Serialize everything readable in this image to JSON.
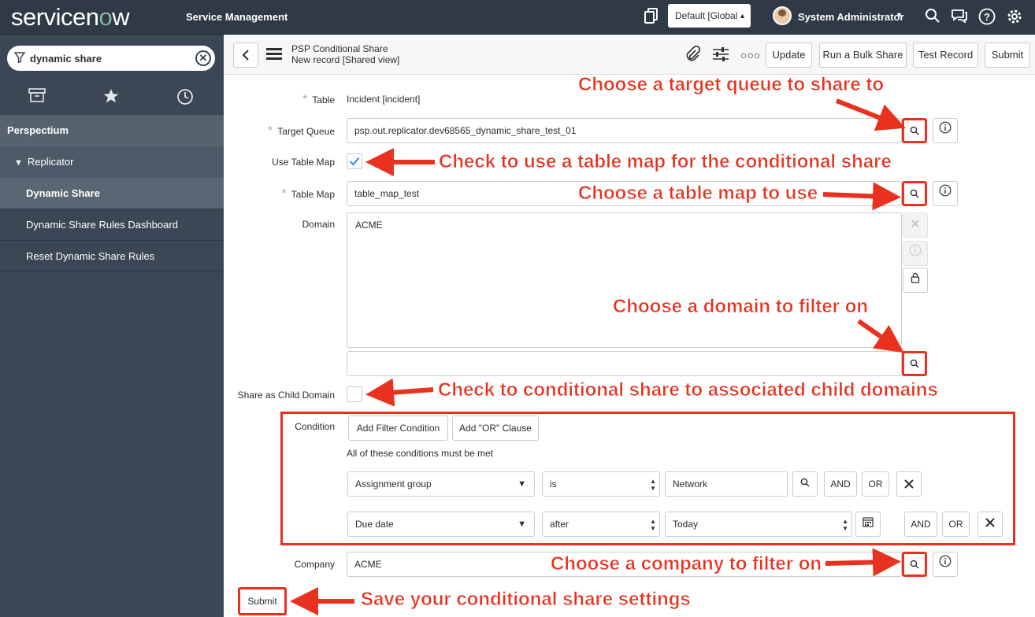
{
  "topbar": {
    "logo_a": "service",
    "logo_o": "n",
    "logo_b": "w",
    "product": "Service Management",
    "scope": "Default [Global",
    "user": "System Administrator",
    "icons": [
      "copy-icon",
      "search-icon",
      "chat-icon",
      "help-icon",
      "gear-icon"
    ]
  },
  "sidebar": {
    "filter_value": "dynamic share",
    "tabs": [
      "archive-icon",
      "star-icon",
      "history-icon"
    ],
    "app": "Perspectium",
    "module": "Replicator",
    "items": [
      {
        "label": "Dynamic Share"
      },
      {
        "label": "Dynamic Share Rules Dashboard"
      },
      {
        "label": "Reset Dynamic Share Rules"
      }
    ]
  },
  "header": {
    "title": "PSP Conditional Share",
    "subtitle": "New record [Shared view]",
    "buttons": {
      "update": "Update",
      "bulk": "Run a Bulk Share",
      "test": "Test Record",
      "submit": "Submit"
    }
  },
  "form": {
    "table_label": "Table",
    "table_value": "Incident [incident]",
    "target_queue_label": "Target Queue",
    "target_queue_value": "psp.out.replicator.dev68565_dynamic_share_test_01",
    "use_table_map_label": "Use Table Map",
    "use_table_map_checked": true,
    "table_map_label": "Table Map",
    "table_map_value": "table_map_test",
    "domain_label": "Domain",
    "domain_value": "ACME",
    "share_child_label": "Share as Child Domain",
    "share_child_checked": false,
    "condition_label": "Condition",
    "add_filter": "Add Filter Condition",
    "add_or": "Add \"OR\" Clause",
    "conditions_note": "All of these conditions must be met",
    "conditions": [
      {
        "field": "Assignment group",
        "operator": "is",
        "value": "Network"
      },
      {
        "field": "Due date",
        "operator": "after",
        "value": "Today"
      }
    ],
    "and_label": "AND",
    "or_label": "OR",
    "company_label": "Company",
    "company_value": "ACME",
    "submit": "Submit"
  },
  "annotations": {
    "target_queue": "Choose a target queue to share to",
    "use_table_map": "Check to use a table map for the conditional share",
    "table_map": "Choose a table map to use",
    "domain": "Choose a domain to filter on",
    "child_domain": "Check to conditional share to associated child domains",
    "company": "Choose a company to filter on",
    "submit": "Save your conditional share settings"
  },
  "colors": {
    "topbar": "#303a46",
    "sidebar": "#3b4754",
    "annotation": "#e8321f",
    "check": "#278efc"
  }
}
